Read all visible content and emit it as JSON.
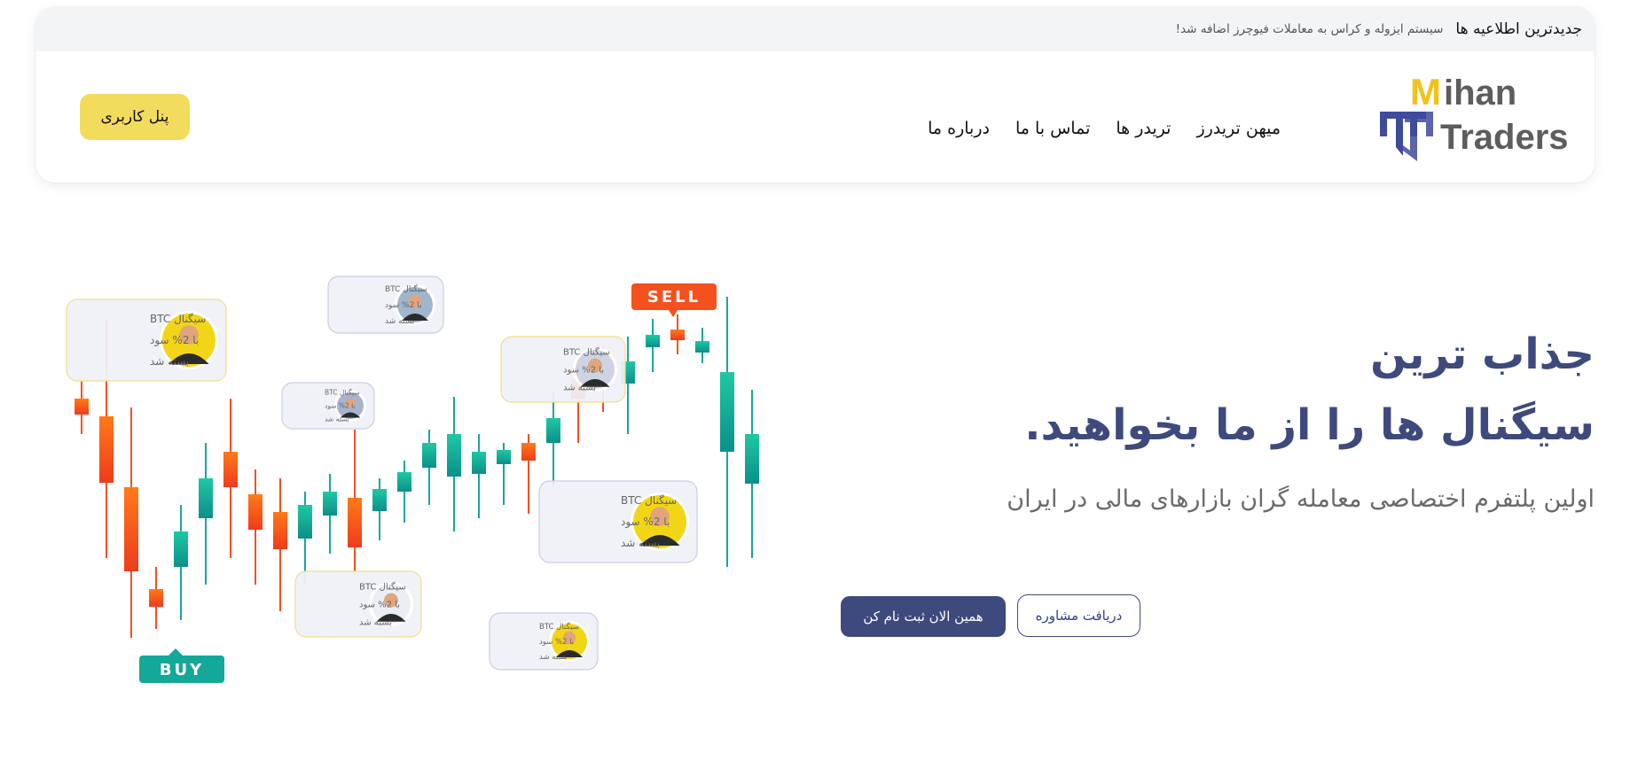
{
  "news": {
    "title": "جدیدترین اطلاعیه ها",
    "text": "سیستم ایزوله و کراس به معاملات فیوچرز اضافه شد!"
  },
  "logo": {
    "line1": "Mihan",
    "line2": "Traders",
    "colors": {
      "accent": "#f2c21b",
      "text": "#5d5d5d",
      "mark": "#3e4a9a"
    }
  },
  "nav": {
    "items": [
      {
        "label": "میهن تریدرز"
      },
      {
        "label": "تریدر ها"
      },
      {
        "label": "تماس با ما"
      },
      {
        "label": "درباره ما"
      }
    ]
  },
  "header": {
    "panel_button": "پنل کاربری"
  },
  "hero": {
    "title_line1": "جذاب ترین",
    "title_line2": "سیگنال ها را از ما بخواهید.",
    "subtitle": "اولین پلتفرم اختصاصی معامله گران بازارهای مالی در ایران",
    "cta_primary": "همین الان ثبت نام کن",
    "cta_secondary": "دریافت مشاوره"
  },
  "illustration": {
    "sell_label": "SELL",
    "buy_label": "BUY",
    "signal_cards": [
      {
        "line1": "سیگنال BTC",
        "line2": "با 2% سود",
        "line3": "بسته شد"
      },
      {
        "line1": "سیگنال BTC",
        "line2": "با 2% سود",
        "line3": "بسته شد"
      },
      {
        "line1": "سیگنال BTC",
        "line2": "با 2% سود",
        "line3": "بسته شد"
      },
      {
        "line1": "سیگنال BTC",
        "line2": "با 2% سود",
        "line3": "بسته شد"
      },
      {
        "line1": "سیگنال BTC",
        "line2": "با 2% سود",
        "line3": "بسته شد"
      },
      {
        "line1": "سیگنال BTC",
        "line2": "با 2% سود",
        "line3": "بسته شد"
      },
      {
        "line1": "سیگنال BTC",
        "line2": "با 2% سود",
        "line3": "بسته شد"
      }
    ],
    "colors": {
      "up": "#14a899",
      "down": "#f4511e",
      "sell": "#f4511e",
      "buy": "#14a899"
    }
  },
  "theme": {
    "primary": "#3e4a7d",
    "yellow": "#f2dc5d"
  }
}
